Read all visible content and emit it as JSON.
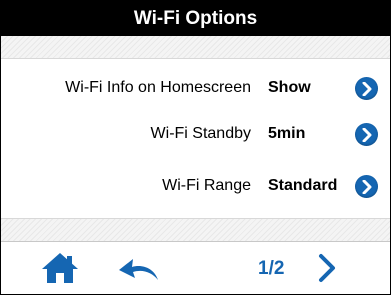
{
  "title": "Wi-Fi Options",
  "settings": [
    {
      "label": "Wi-Fi Info on Homescreen",
      "value": "Show"
    },
    {
      "label": "Wi-Fi Standby",
      "value": "5min"
    },
    {
      "label": "Wi-Fi Range",
      "value": "Standard"
    }
  ],
  "pagination": {
    "indicator": "1/2"
  },
  "icons": {
    "row": "chevron-right-circle-icon",
    "home": "home-icon",
    "back": "back-arrow-icon",
    "next": "chevron-right-icon"
  },
  "colors": {
    "accent": "#1566b2",
    "titlebar": "#000000"
  }
}
